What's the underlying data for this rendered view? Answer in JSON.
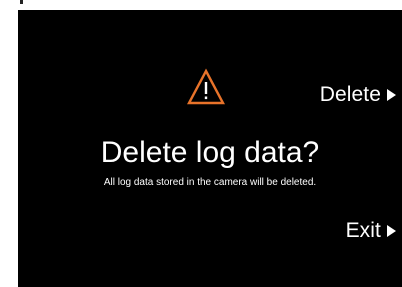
{
  "dialog": {
    "title": "Delete log data?",
    "message": "All log data stored in the camera will be deleted.",
    "warning_icon": "warning-triangle-icon",
    "accent_color": "#e8732a"
  },
  "actions": {
    "delete_label": "Delete",
    "exit_label": "Exit",
    "arrow_icon": "right-triangle-icon"
  }
}
